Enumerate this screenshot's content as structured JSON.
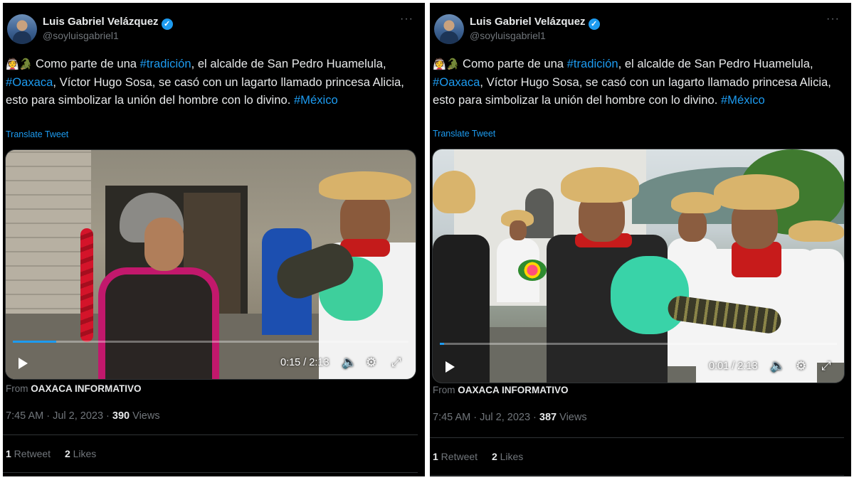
{
  "tweets": [
    {
      "author_name": "Luis Gabriel Velázquez",
      "verified_mark": "✓",
      "handle": "@soyluisgabriel1",
      "more_label": "···",
      "emoji": "👰🐊",
      "text_1": " Como parte de una ",
      "tag_1": "#tradición",
      "text_2": ", el alcalde de San Pedro Huamelula, ",
      "tag_2": "#Oaxaca",
      "text_3": ", Víctor Hugo Sosa, se casó con un lagarto llamado princesa Alicia, esto para simbolizar la unión del hombre con lo divino. ",
      "tag_3": "#México",
      "translate_label": "Translate Tweet",
      "video_time": "0:15 / 2:13",
      "video_progress": 0.11,
      "from_prefix": "From ",
      "from_source": "OAXACA INFORMATIVO",
      "timestamp": "7:45 AM · Jul 2, 2023 · ",
      "views_count": "390",
      "views_label": " Views",
      "retweets_count": "1",
      "retweets_label": " Retweet",
      "likes_count": "2",
      "likes_label": " Likes"
    },
    {
      "author_name": "Luis Gabriel Velázquez",
      "verified_mark": "✓",
      "handle": "@soyluisgabriel1",
      "more_label": "···",
      "emoji": "👰🐊",
      "text_1": " Como parte de una ",
      "tag_1": "#tradición",
      "text_2": ", el alcalde de San Pedro Huamelula, ",
      "tag_2": "#Oaxaca",
      "text_3": ", Víctor Hugo Sosa, se casó con un lagarto llamado princesa Alicia, esto para simbolizar la unión del hombre con lo divino. ",
      "tag_3": "#México",
      "translate_label": "Translate Tweet",
      "video_time": "0:01 / 2:13",
      "video_progress": 0.01,
      "from_prefix": "From ",
      "from_source": "OAXACA INFORMATIVO",
      "timestamp": "7:45 AM · Jul 2, 2023 · ",
      "views_count": "387",
      "views_label": " Views",
      "retweets_count": "1",
      "retweets_label": " Retweet",
      "likes_count": "2",
      "likes_label": " Likes"
    }
  ],
  "icons": {
    "play": "play-icon",
    "volume": "volume-icon",
    "settings": "gear-icon",
    "fullscreen": "expand-icon"
  },
  "colors": {
    "background": "#000000",
    "text": "#e7e9ea",
    "secondary": "#71767b",
    "accent": "#1d9bf0"
  }
}
